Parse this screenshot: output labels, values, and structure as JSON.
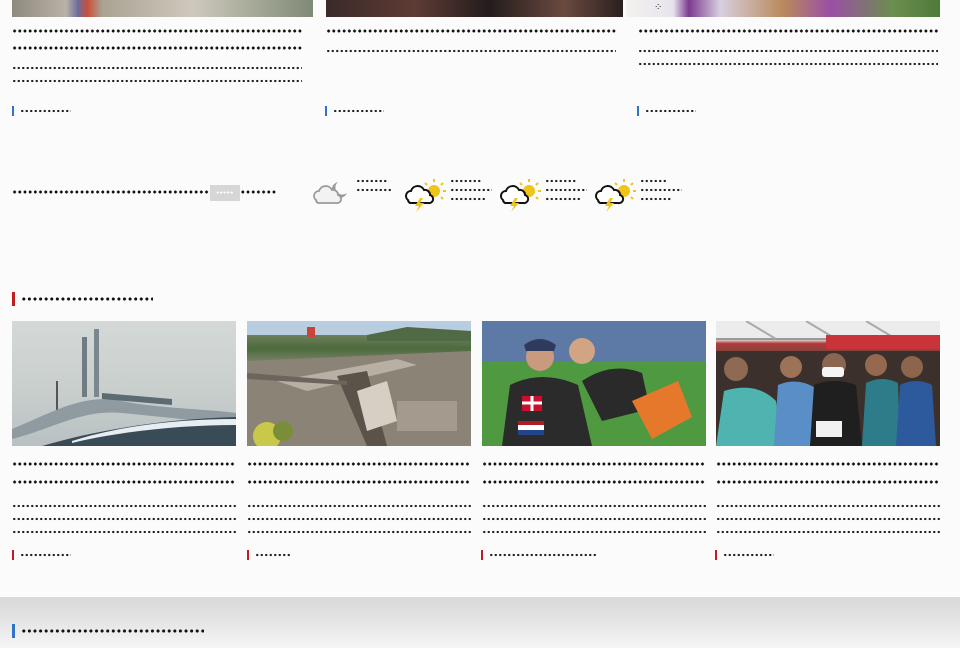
{
  "top_articles": [
    {
      "title_lines": [
        "●●●●●●●●●●' ●●●●●' ●●●●●●'' ●●' ●●●●●●●●●●● ●●●●●●●' ●●●●",
        "●●●●●●●●●"
      ],
      "excerpt_lines": [
        "●●●●●●●●●' ●●●●●●' ●●●●●●'' ●●●●● ●●●●●●' ●●' ●●●●●●● ●●●●● ●●●●●●' ●●●●'",
        "●●●●●' ●●●●●●'"
      ],
      "category": "●●●●●●●'"
    },
    {
      "title_lines": [
        "●●●●● ●●●●●●● ●●●●●' ●●●●●●●●●●●●●● ●●●●●●●●'"
      ],
      "excerpt_lines": [
        "●●●●●●●' ●●●● ●●● ●●●●●●' ●● ●●●●' ●●●●●●●●' ●●●●●●●●"
      ],
      "category": "●●●●●●●'"
    },
    {
      "title_lines": [
        "●●●●●●' ● ●●●●●'' ●●●●●●●●●●●' ●●●' ●●●●●●●●●●●●●● ●●●●●●●●●●"
      ],
      "excerpt_lines": [
        "●●●●●●●●' ●●● ●●●●●●●●●●●● ●●●●●●●●' ●●●●●●●●●●●●●●●●●●● ●●●● ●●● ●●●●●",
        "●●●●●●●●●●"
      ],
      "category": "●●●●●●●'"
    }
  ],
  "weather": {
    "label": "●●●●●●●●●●●●●●●●●● ●●●●●●●●●●●●●●●'",
    "button_label": "●●●●●●",
    "days": [
      {
        "icon": "partly-cloudy-night-icon",
        "lines": [
          "●●●●●●",
          "●●●●●●●"
        ]
      },
      {
        "icon": "thunderstorm-icon",
        "lines": [
          "●●●●●●",
          "●●●●●●●●",
          "●●●●●●●"
        ]
      },
      {
        "icon": "thunderstorm-icon",
        "lines": [
          "●●●●●●",
          "●●●●●●●●",
          "●●●●●●●"
        ]
      },
      {
        "icon": "thunderstorm-icon",
        "lines": [
          "●●●●●",
          "●●●●●●●●",
          "●●●●●●"
        ]
      }
    ]
  },
  "section": {
    "title": "●●●●●● ●●●●●●●'",
    "accent_color": "#c01d1d",
    "articles": [
      {
        "image": "bridge-photo",
        "title_lines": [
          "●●●●●●●'' ●●●●●●●● ●●●●●●●●●●'",
          "●●●●●●●●●●●●●●●●●●' ●●●●●●●●●"
        ],
        "excerpt_lines": [
          "●●●'' ●●●●●●●'' ●●●●●●●'' ●●●●●●●●●●●' ●●●●●●● ●● ●●●",
          "●●●●●●●●●●●●●●● ●●●●●●●●●' ●●●● ●●●●' ●●●●●●' ●●●●●●●●●'",
          "●●● ●●●●●●●' ●●●●●●●● ●●●●● ●●●●●●●●●"
        ],
        "category": "●●●●●●●'"
      },
      {
        "image": "train-wreck-photo",
        "title_lines": [
          "●●●●●●'' ●●●●●●●' ●●●●●●●● ●●●●●●●●●●'",
          "●●●●●●●●' ●●●●●●●●●●"
        ],
        "excerpt_lines": [
          "●●●●●●●●●●● ●●●●●●●●●●' ●●●●●' ●●●●●●● ●' ●●●●●●●●●●●●'",
          "●●●●' ●●●●●●●●●' '' ●●●●●●●●●● ●●●●●●● ●●●'",
          "●●●●●●●●●● ●● ●●●●●●●●●●●'"
        ],
        "category": "●●●●●'"
      },
      {
        "image": "athletes-embrace-photo",
        "title_lines": [
          "●●●●●●●●●●' ●●●●●●●●●' ●●●●●●●●●●●●●● ●●'",
          "●●●●●●●●●● ●●●●●●●●●●●●"
        ],
        "excerpt_lines": [
          "●●●'' ●●●●●●●●●●●●● ●●●●●● ●●●●●●●' ●●●●● ●●●●●●●●●●●●",
          "●● ●●●' ●●●●●●●●●●●'' ●●●●●' ●●●●●●● ●●●●●●●●●●' ●●●",
          "●● ●●●●●●●●●●●●"
        ],
        "category": "●●●●●●●●●●●●●●●'"
      },
      {
        "image": "marathon-runners-photo",
        "title_lines": [
          "●●●●●● ●' ●●●●●● ●●●●●●●' ●●●●' ●●' ●●●●●●●●●'",
          "●●●●● ●●●●●●●●"
        ],
        "excerpt_lines": [
          "●●●●●●●●●' ●●●●●●●●●●' ●●●●●●●●●●●' ●●●● ●● ●●●●●●●●",
          "●●●●●●● ●●' ●●●●●●●●●●●' ●●' ●●●●●●● ●●●●●●●' ●●●●",
          "●●●●●●●'' ●●●●●●●●● ●●●●●●●●●'"
        ],
        "category": "●●●●●●●'"
      }
    ]
  },
  "next_section": {
    "title": "●●●●●●●●●●●' ●●●●●●●'",
    "accent_color": "#2f73c9"
  }
}
